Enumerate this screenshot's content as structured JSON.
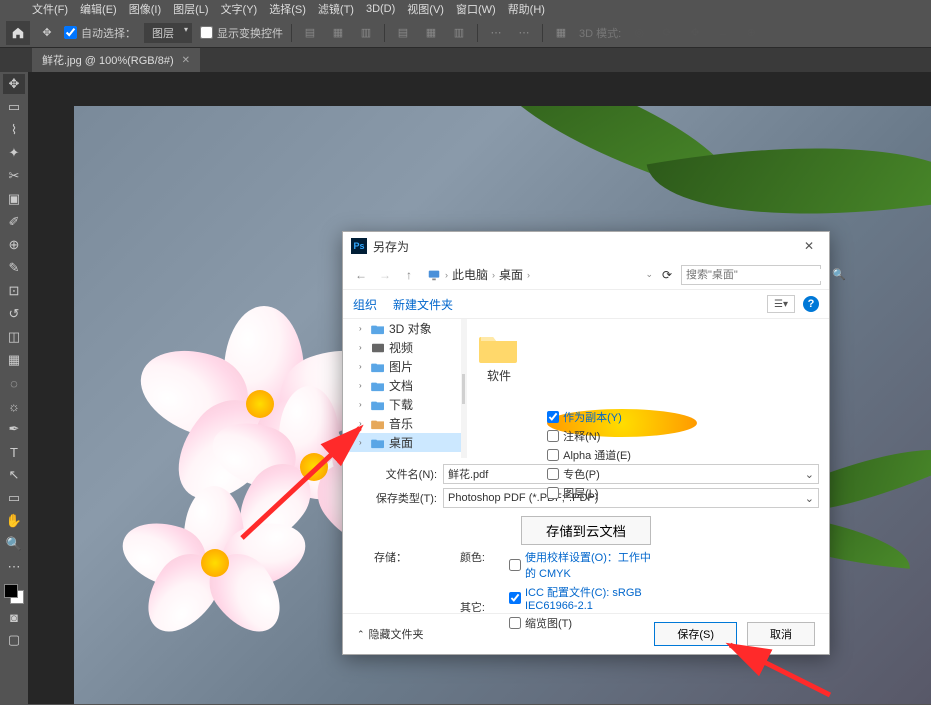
{
  "menubar": [
    "文件(F)",
    "编辑(E)",
    "图像(I)",
    "图层(L)",
    "文字(Y)",
    "选择(S)",
    "滤镜(T)",
    "3D(D)",
    "视图(V)",
    "窗口(W)",
    "帮助(H)"
  ],
  "optionbar": {
    "auto_select_label": "自动选择：",
    "layer_dropdown": "图层",
    "transform_controls_label": "显示变换控件",
    "mode_3d_label": "3D 模式:"
  },
  "document_tab": {
    "label": "鲜花.jpg @ 100%(RGB/8#)"
  },
  "dialog": {
    "title": "另存为",
    "breadcrumb": [
      "此电脑",
      "桌面"
    ],
    "search_placeholder": "搜索\"桌面\"",
    "organize": "组织",
    "new_folder": "新建文件夹",
    "tree": [
      {
        "label": "3D 对象"
      },
      {
        "label": "视频"
      },
      {
        "label": "图片"
      },
      {
        "label": "文档"
      },
      {
        "label": "下载"
      },
      {
        "label": "音乐"
      },
      {
        "label": "桌面",
        "selected": true
      }
    ],
    "file_item": "软件",
    "filename_label": "文件名(N):",
    "filename_value": "鲜花.pdf",
    "filetype_label": "保存类型(T):",
    "filetype_value": "Photoshop PDF (*.PDF;*.PDP)",
    "cloud_button": "存储到云文档",
    "save_group_label": "存储：",
    "as_copy": "作为副本(Y)",
    "annotations": "注释(N)",
    "alpha": "Alpha 通道(E)",
    "spot": "专色(P)",
    "layers": "图层(L)",
    "color_group_label": "颜色:",
    "use_proof": "使用校样设置(O)：工作中的 CMYK",
    "icc": "ICC 配置文件(C): sRGB IEC61966-2.1",
    "other_group_label": "其它:",
    "thumbnail": "缩览图(T)",
    "hide_folders": "隐藏文件夹",
    "save_btn": "保存(S)",
    "cancel_btn": "取消"
  }
}
